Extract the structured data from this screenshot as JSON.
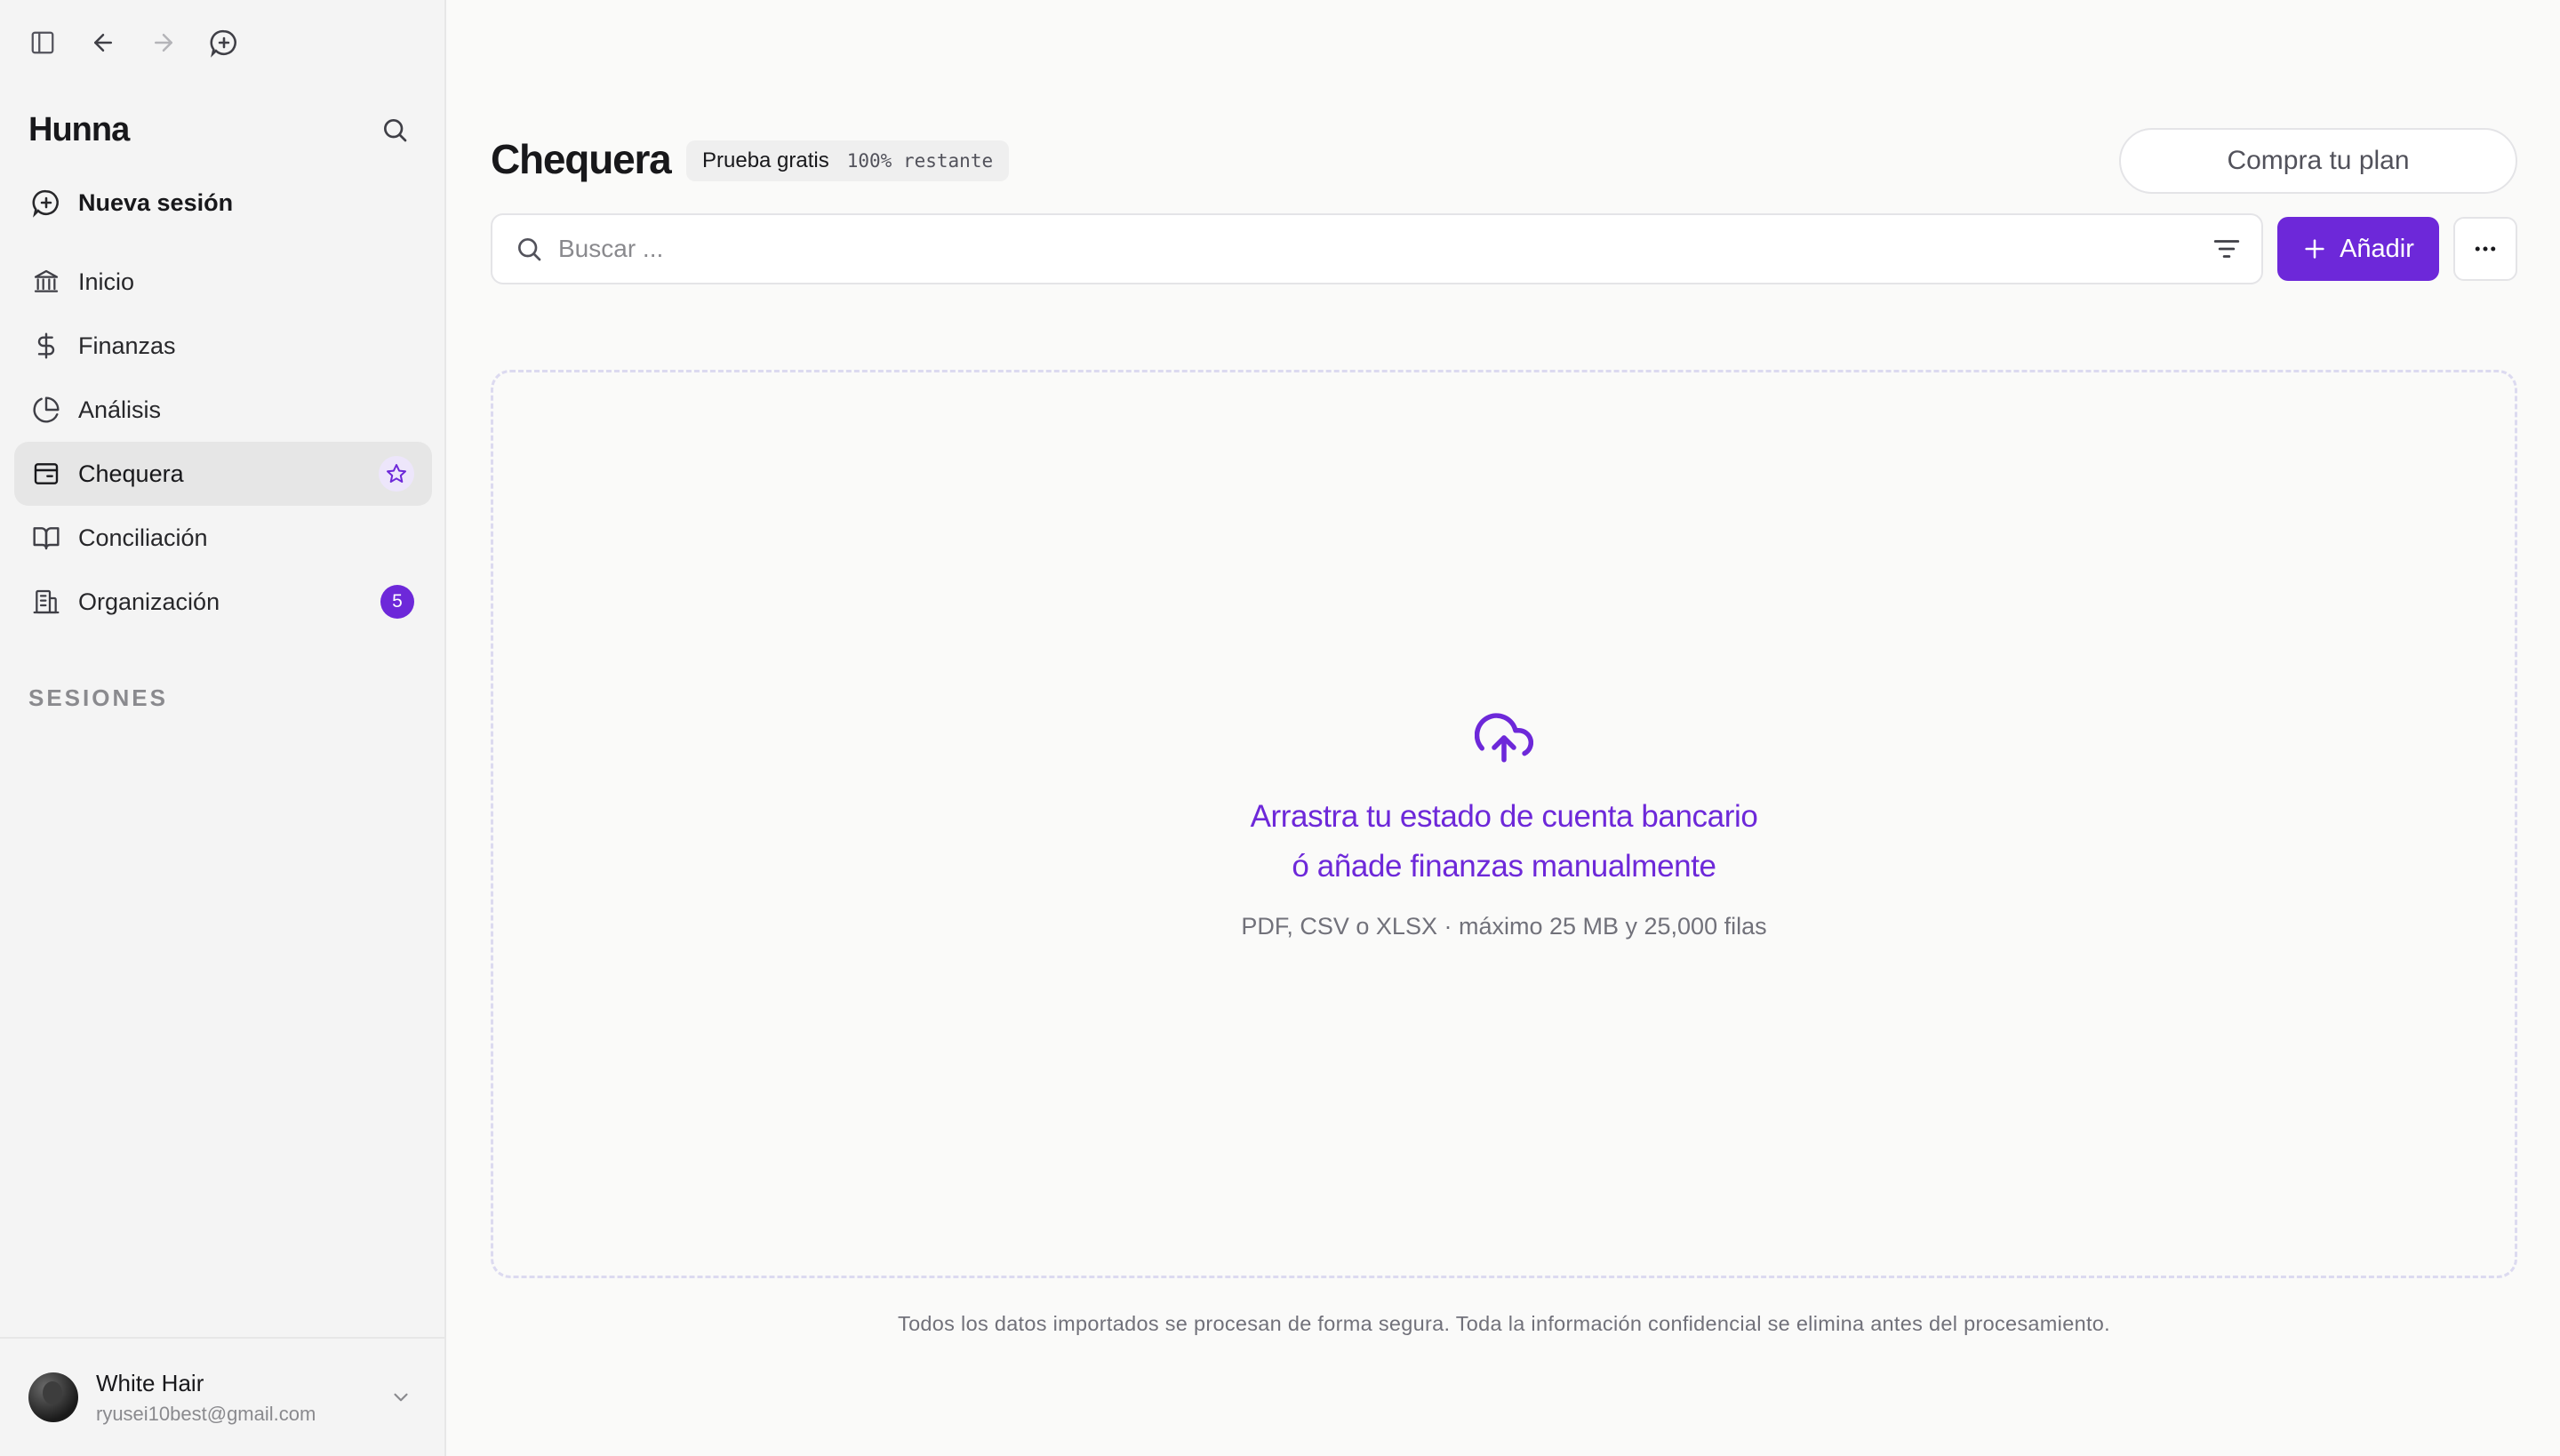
{
  "sidebar": {
    "brand": "Hunna",
    "new_session": "Nueva sesión",
    "items": [
      {
        "label": "Inicio",
        "icon": "bank-icon"
      },
      {
        "label": "Finanzas",
        "icon": "dollar-icon"
      },
      {
        "label": "Análisis",
        "icon": "pie-chart-icon"
      },
      {
        "label": "Chequera",
        "icon": "wallet-icon",
        "active": true
      },
      {
        "label": "Conciliación",
        "icon": "book-open-icon"
      },
      {
        "label": "Organización",
        "icon": "building-icon",
        "badge": "5"
      }
    ],
    "section_label": "SESIONES",
    "user": {
      "name": "White Hair",
      "email": "ryusei10best@gmail.com"
    }
  },
  "header": {
    "title": "Chequera",
    "trial_label": "Prueba gratis",
    "trial_remaining": "100% restante",
    "buy_label": "Compra tu plan"
  },
  "toolbar": {
    "search_placeholder": "Buscar ...",
    "add_label": "Añadir"
  },
  "dropzone": {
    "line1": "Arrastra tu estado de cuenta bancario",
    "line2": "ó añade finanzas manualmente",
    "subtext": "PDF, CSV o XLSX · máximo 25 MB y 25,000 filas"
  },
  "footnote": "Todos los datos importados se procesan de forma segura. Toda la información confidencial se elimina antes del procesamiento.",
  "colors": {
    "accent": "#6d28d9",
    "background": "#fafaf9",
    "sidebar": "#f4f4f4"
  }
}
